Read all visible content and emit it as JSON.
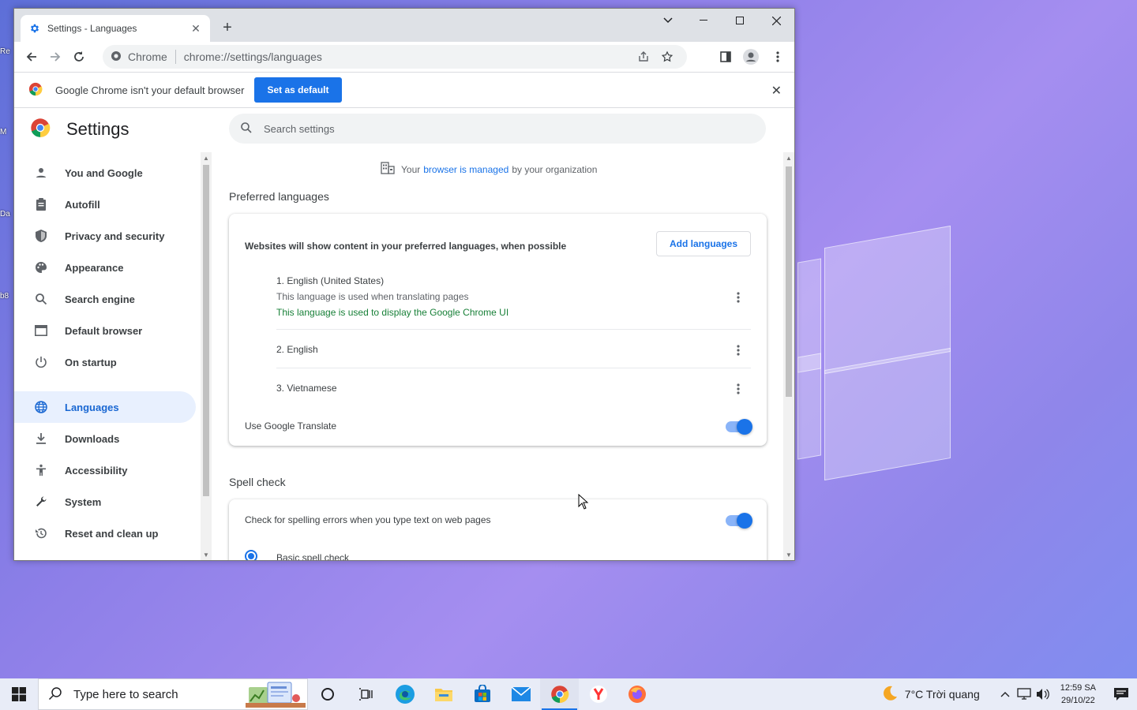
{
  "colors": {
    "accent": "#1a73e8",
    "active_nav_bg": "#e8f0fe",
    "green_text": "#188038"
  },
  "desktop": {
    "edge_labels": [
      "Re",
      "M",
      "Da",
      "b8"
    ]
  },
  "browser": {
    "tab": {
      "title": "Settings - Languages",
      "icon": "settings-gear-icon"
    },
    "omnibox": {
      "site": "Chrome",
      "url": "chrome://settings/languages"
    }
  },
  "infobar": {
    "message": "Google Chrome isn't your default browser",
    "button": "Set as default"
  },
  "settings": {
    "title": "Settings",
    "search_placeholder": "Search settings",
    "nav": [
      {
        "label": "You and Google",
        "icon": "person-icon"
      },
      {
        "label": "Autofill",
        "icon": "clipboard-icon"
      },
      {
        "label": "Privacy and security",
        "icon": "shield-icon"
      },
      {
        "label": "Appearance",
        "icon": "palette-icon"
      },
      {
        "label": "Search engine",
        "icon": "search-icon"
      },
      {
        "label": "Default browser",
        "icon": "browser-window-icon"
      },
      {
        "label": "On startup",
        "icon": "power-icon"
      },
      {
        "label": "Languages",
        "icon": "globe-icon",
        "active": true
      },
      {
        "label": "Downloads",
        "icon": "download-icon"
      },
      {
        "label": "Accessibility",
        "icon": "accessibility-icon"
      },
      {
        "label": "System",
        "icon": "wrench-icon"
      },
      {
        "label": "Reset and clean up",
        "icon": "history-icon"
      }
    ],
    "managed": {
      "prefix": "Your",
      "link": "browser is managed",
      "suffix": "by your organization"
    },
    "preferred": {
      "title": "Preferred languages",
      "description": "Websites will show content in your preferred languages, when possible",
      "add_button": "Add languages",
      "languages": [
        {
          "name": "1. English (United States)",
          "sub1": "This language is used when translating pages",
          "sub2": "This language is used to display the Google Chrome UI"
        },
        {
          "name": "2. English"
        },
        {
          "name": "3. Vietnamese"
        }
      ],
      "translate_label": "Use Google Translate",
      "translate_on": true
    },
    "spell": {
      "title": "Spell check",
      "check_label": "Check for spelling errors when you type text on web pages",
      "check_on": true,
      "basic_label": "Basic spell check"
    }
  },
  "taskbar": {
    "search_placeholder": "Type here to search",
    "weather": "7°C  Trời quang",
    "time": "12:59 SA",
    "date": "29/10/22"
  }
}
